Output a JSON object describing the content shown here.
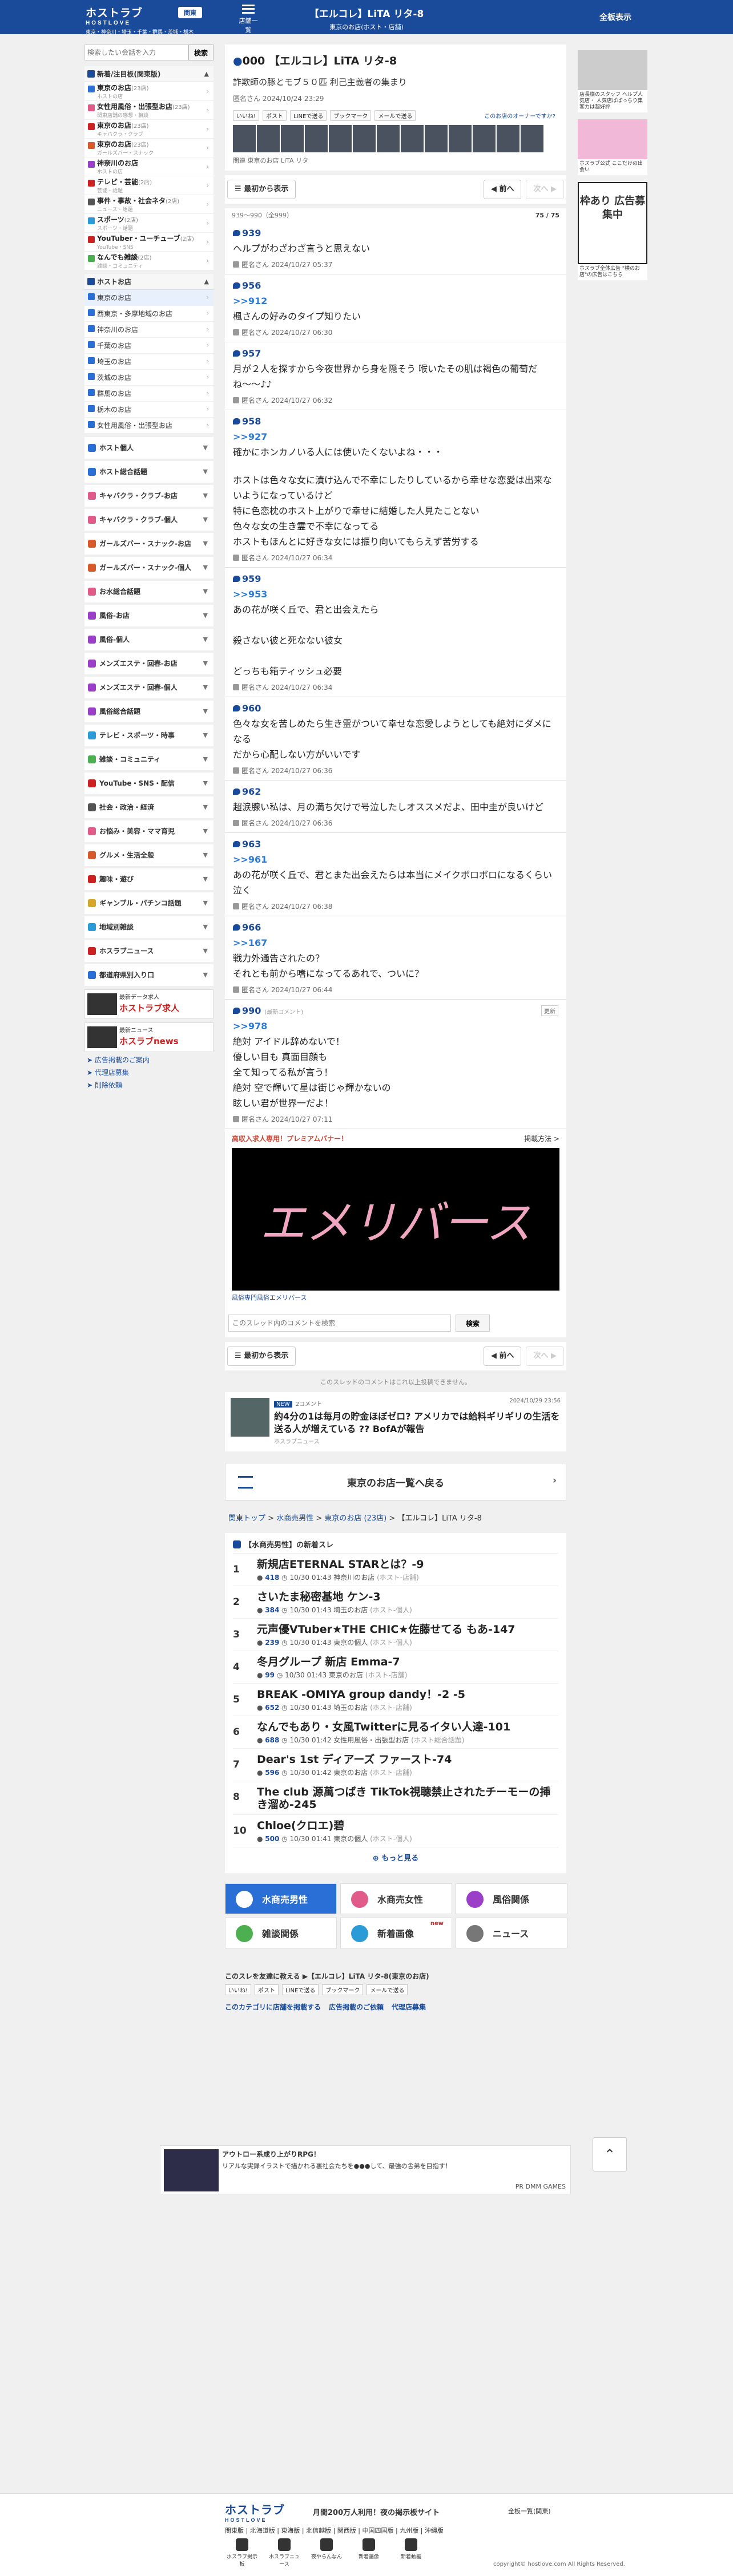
{
  "header": {
    "logo": "ホストラブ",
    "logo_sub": "HOSTLOVE",
    "region": "東京・神奈川・埼玉・千葉・群馬・茨城・栃木",
    "region_btn": "関東",
    "menu_label": "店舗一覧",
    "title": "【エルコレ】LiTA リタ-8",
    "subtitle": "東京のお店(ホスト・店舗)",
    "all_display": "全板表示"
  },
  "sidebar": {
    "search_placeholder": "検索したい会話を入力",
    "search_btn": "検索",
    "sec1": "新着/注目板(関東版)",
    "items1": [
      {
        "name": "東京のお店",
        "count": "(23店)",
        "sub": "ホストの店"
      },
      {
        "name": "女性用風俗・出張型お店",
        "count": "(23店)",
        "sub": "関東店舗の感想・相談"
      },
      {
        "name": "東京のお店",
        "count": "(23店)",
        "sub": "キャバクラ・クラブ"
      },
      {
        "name": "東京のお店",
        "count": "(23店)",
        "sub": "ガールズバー・スナック"
      },
      {
        "name": "神奈川のお店",
        "count": "",
        "sub": "ホストの店"
      },
      {
        "name": "テレビ・芸能",
        "count": "(2店)",
        "sub": "芸能・話題"
      },
      {
        "name": "事件・事故・社会ネタ",
        "count": "(2店)",
        "sub": "ニュース・話題"
      },
      {
        "name": "スポーツ",
        "count": "(2店)",
        "sub": "スポーツ・話題"
      },
      {
        "name": "YouTuber・ユーチューブ",
        "count": "(2店)",
        "sub": "YouTube・SNS"
      },
      {
        "name": "なんでも雑談",
        "count": "(2店)",
        "sub": "雑談・コミュニティ"
      }
    ],
    "sec2": "ホストお店",
    "items2": [
      "東京のお店",
      "西東京・多摩地域のお店",
      "神奈川のお店",
      "千葉のお店",
      "埼玉のお店",
      "茨城のお店",
      "群馬のお店",
      "栃木のお店",
      "女性用風俗・出張型お店"
    ],
    "bars": [
      "ホスト個人",
      "ホスト総合話題",
      "キャバクラ・クラブ-お店",
      "キャバクラ・クラブ-個人",
      "ガールズバー・スナック-お店",
      "ガールズバー・スナック-個人",
      "お水総合話題",
      "風俗-お店",
      "風俗-個人",
      "メンズエステ・回春-お店",
      "メンズエステ・回春-個人",
      "風俗総合話題",
      "テレビ・スポーツ・時事",
      "雑談・コミュニティ",
      "YouTube・SNS・配信",
      "社会・政治・経済",
      "お悩み・美容・ママ育児",
      "グルメ・生活全般",
      "趣味・遊び",
      "ギャンブル・パチンコ話題",
      "地域別雑談",
      "ホスラブニュース",
      "都道府県別入り口"
    ],
    "banner1": "ホストラブ求人",
    "banner1_sub": "最新データ求人",
    "banner2": "ホスラブnews",
    "banner2_sub": "最新ニュース",
    "links": [
      "広告掲載のご案内",
      "代理店募集",
      "削除依頼"
    ]
  },
  "thread": {
    "num": "000",
    "title": "【エルコレ】LiTA リタ-8",
    "body": "詐欺師の豚とモブ５０匹 利己主義者の集まり",
    "who": "匿名さん",
    "date": "2024/10/24 23:29",
    "owner_link": "このお店のオーナーですか?",
    "tags": "関連 東京のお店 LiTA リタ",
    "shares": [
      "いいね!",
      "ポスト",
      "LINEで送る",
      "ブックマーク",
      "メールで送る"
    ]
  },
  "nav": {
    "first": "最初から表示",
    "prev": "前へ",
    "next": "次へ",
    "range": "939〜990（全999）",
    "page": "75 / 75"
  },
  "posts": [
    {
      "num": "939",
      "anchor": "",
      "body": "ヘルプがわざわざ言うと思えない",
      "who": "匿名さん",
      "date": "2024/10/27 05:37"
    },
    {
      "num": "956",
      "anchor": ">>912",
      "body": "楓さんの好みのタイプ知りたい",
      "who": "匿名さん",
      "date": "2024/10/27 06:30"
    },
    {
      "num": "957",
      "anchor": "",
      "body": "月が２人を探すから今夜世界から身を隠そう 喉いたその肌は褐色の葡萄だね〜〜♪♪",
      "who": "匿名さん",
      "date": "2024/10/27 06:32"
    },
    {
      "num": "958",
      "anchor": ">>927",
      "body": "確かにホンカノいる人には使いたくないよね・・・",
      "who": "",
      "date": ""
    },
    {
      "num": "",
      "anchor": "",
      "body": "ホストは色々な女に漬け込んで不幸にしたりしているから幸せな恋愛は出来ないようになっているけど\n特に色恋枕のホスト上がりで幸せに結婚した人見たことない\n色々な女の生き霊で不幸になってる\nホストもほんとに好きな女には振り向いてもらえず苦労する",
      "who": "匿名さん",
      "date": "2024/10/27 06:34"
    },
    {
      "num": "959",
      "anchor": ">>953",
      "body": "あの花が咲く丘で、君と出会えたら\n\n殺さない彼と死なない彼女\n\nどっちも箱ティッシュ必要",
      "who": "匿名さん",
      "date": "2024/10/27 06:34"
    },
    {
      "num": "960",
      "anchor": "",
      "body": "色々な女を苦しめたら生き霊がついて幸せな恋愛しようとしても絶対にダメになる\nだから心配しない方がいいです",
      "who": "匿名さん",
      "date": "2024/10/27 06:36"
    },
    {
      "num": "962",
      "anchor": "",
      "body": "超涙腺い私は、月の満ち欠けで号泣したしオススメだよ、田中圭が良いけど",
      "who": "匿名さん",
      "date": "2024/10/27 06:36"
    },
    {
      "num": "963",
      "anchor": ">>961",
      "body": "あの花が咲く丘で、君とまた出会えたらは本当にメイクボロボロになるくらい泣く",
      "who": "匿名さん",
      "date": "2024/10/27 06:38"
    },
    {
      "num": "966",
      "anchor": ">>167",
      "body": "戦力外通告されたの？\nそれとも前から嗜になってるあれで、ついに？",
      "who": "匿名さん",
      "date": "2024/10/27 06:44"
    },
    {
      "num": "990",
      "anchor": ">>978",
      "body": "絶対 アイドル辞めないで！\n優しい目も 真面目顔も\n全て知ってる私が言う！\n絶対 空で輝いて星は街じゃ輝かないの\n眩しい君が世界一だよ！",
      "who": "匿名さん",
      "date": "2024/10/27 07:11",
      "tag": "(最新コメント)",
      "upd": "更新"
    }
  ],
  "premium": {
    "label": "高収入求人専用！プレミアムバナー！",
    "apply": "掲載方法 >",
    "image_text": "エメリバース",
    "caption": "風俗専門風俗エメリバース"
  },
  "comment_search": {
    "placeholder": "このスレッド内のコメントを検索",
    "btn": "検索"
  },
  "note": "このスレッドのコメントはこれ以上投稿できません。",
  "news": {
    "label": "NEW",
    "comments": "2コメント",
    "date": "2024/10/29 23:56",
    "title": "約4分の1は毎月の貯金ほぼゼロ? アメリカでは給料ギリギリの生活を送る人が増えている ?? BofAが報告",
    "source": "ホスラブニュース"
  },
  "tolist": "東京のお店一覧へ戻る",
  "breadcrumb": {
    "a": "関東トップ",
    "b": "水商売男性",
    "c": "東京のお店 (23店)",
    "d": "【エルコレ】LiTA リタ-8"
  },
  "ranking": {
    "head": "【水商売男性】の新着スレ",
    "items": [
      {
        "n": "1",
        "title": "新規店ETERNAL STARとは？-9",
        "cnt": "418",
        "time": "10/30 01:43",
        "cat": "神奈川のお店",
        "sub": "(ホスト-店舗)"
      },
      {
        "n": "2",
        "title": "さいたま秘密基地 ケン-3",
        "cnt": "384",
        "time": "10/30 01:43",
        "cat": "埼玉のお店",
        "sub": "(ホスト-個人)"
      },
      {
        "n": "3",
        "title": "元声優VTuber★THE CHIC★佐藤せてる もあ-147",
        "cnt": "239",
        "time": "10/30 01:43",
        "cat": "東京の個人",
        "sub": "(ホスト-個人)"
      },
      {
        "n": "4",
        "title": "冬月グループ 新店 Emma-7",
        "cnt": "99",
        "time": "10/30 01:43",
        "cat": "東京のお店",
        "sub": "(ホスト-店舗)"
      },
      {
        "n": "5",
        "title": "BREAK -OMIYA group dandy！-2 -5",
        "cnt": "652",
        "time": "10/30 01:43",
        "cat": "埼玉のお店",
        "sub": "(ホスト-店舗)"
      },
      {
        "n": "6",
        "title": "なんでもあり・女風Twitterに見るイタい人達-101",
        "cnt": "688",
        "time": "10/30 01:42",
        "cat": "女性用風俗・出張型お店",
        "sub": "(ホスト総合話題)"
      },
      {
        "n": "7",
        "title": "Dear's 1st ディアーズ ファースト-74",
        "cnt": "596",
        "time": "10/30 01:42",
        "cat": "東京のお店",
        "sub": "(ホスト-店舗)"
      },
      {
        "n": "8",
        "title": "The club 源萬つばき TikTok視聴禁止されたチーモーの挿き溜め-245",
        "cnt": "",
        "time": "",
        "cat": "",
        "sub": ""
      },
      {
        "n": "10",
        "title": "Chloe(クロエ)碧",
        "cnt": "500",
        "time": "10/30 01:41",
        "cat": "東京の個人",
        "sub": "(ホスト-個人)"
      }
    ],
    "more": "もっと見る"
  },
  "ad": {
    "title": "アウトロー系成り上がりRPG！",
    "desc": "リアルな実録イラストで描かれる裏社会たちを●●●して、最強の舎弟を目指す！",
    "pr": "PR DMM GAMES"
  },
  "cats": [
    {
      "label": "水商売男性",
      "on": true,
      "color": "#2a6fd6"
    },
    {
      "label": "水商売女性",
      "on": false,
      "color": "#e05a8a"
    },
    {
      "label": "風俗関係",
      "on": false,
      "color": "#9b3fc9"
    },
    {
      "label": "雑談関係",
      "on": false,
      "color": "#4caf50"
    },
    {
      "label": "新着画像",
      "on": false,
      "color": "#2a9bd6",
      "new": "new"
    },
    {
      "label": "ニュース",
      "on": false,
      "color": "#777"
    }
  ],
  "bottom_share": {
    "head": "このスレを友達に教える ▶【エルコレ】LiTA リタ-8(東京のお店)",
    "items": [
      "いいね!",
      "ポスト",
      "LINEで送る",
      "ブックマーク",
      "メールで送る"
    ],
    "links": [
      "このカテゴリに店舗を掲載する",
      "広告掲載のご依頼",
      "代理店募集"
    ]
  },
  "footer": {
    "logo": "ホストラブ",
    "logo_sub": "HOSTLOVE",
    "slogan": "月間200万人利用！夜の掲示板サイト",
    "all": "全板一覧(関東)",
    "regions": "関東版 | 北海道版 | 東海版 | 北信越版 | 関西版 | 中国四国版 | 九州版 | 沖縄版",
    "icons": [
      "ホスラブ掲示板",
      "ホスラブニュース",
      "夜やらんなん",
      "新着画像",
      "新着動画"
    ],
    "copyright": "copyright© hostlove.com All Rights Reserved."
  },
  "right": {
    "b1": "店長様のスタッフ ヘルプ人気店・ 人気店ぱばっちり集客力は超好評",
    "b2": "ホスラブ公式 ここだけの出会い",
    "b3": "枠あり 広告募集中",
    "b3_sub": "ホスラブ全体広告 \"横のお店\"の広告はこちら"
  }
}
